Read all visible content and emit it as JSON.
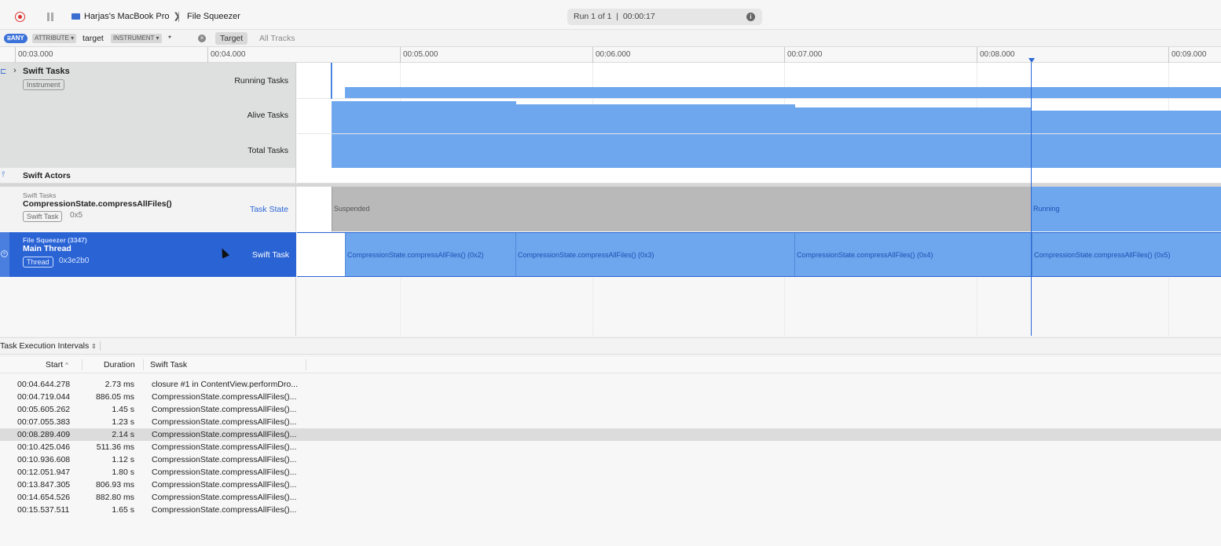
{
  "toolbar": {
    "device": "Harjas's MacBook Pro",
    "separator": "❯",
    "target": "File Squeezer",
    "run_info": "Run 1 of 1  |  00:00:17",
    "info_icon": "i"
  },
  "filter": {
    "any_label": "ANY",
    "attribute_label": "ATTRIBUTE",
    "attribute_value": "target",
    "instrument_label": "INSTRUMENT",
    "instrument_value": "*",
    "target_button": "Target",
    "all_tracks_button": "All Tracks"
  },
  "ruler": {
    "ticks": [
      "00:03.000",
      "00:04.000",
      "00:05.000",
      "00:06.000",
      "00:07.000",
      "00:08.000",
      "00:09.000"
    ]
  },
  "tracks": {
    "swift_tasks": {
      "title": "Swift Tasks",
      "badge": "Instrument",
      "rows": [
        "Running Tasks",
        "Alive Tasks",
        "Total Tasks"
      ]
    },
    "swift_actors": {
      "title": "Swift Actors"
    },
    "task_state": {
      "subtitle": "Swift Tasks",
      "title": "CompressionState.compressAllFiles()",
      "badge": "Swift Task",
      "id": "0x5",
      "lane_label": "Task State",
      "state_suspended": "Suspended",
      "state_running": "Running"
    },
    "main_thread": {
      "subtitle": "File Squeezer (3347)",
      "title": "Main Thread",
      "badge": "Thread",
      "id": "0x3e2b0",
      "lane_label": "Swift Task",
      "segments": [
        "CompressionState.compressAllFiles() (0x2)",
        "CompressionState.compressAllFiles() (0x3)",
        "CompressionState.compressAllFiles() (0x4)",
        "CompressionState.compressAllFiles() (0x5)"
      ]
    }
  },
  "detail": {
    "selector": "Task Execution Intervals",
    "columns": {
      "start": "Start",
      "duration": "Duration",
      "task": "Swift Task"
    },
    "rows": [
      {
        "start": "00:04.644.278",
        "duration": "2.73 ms",
        "task": "closure #1 in ContentView.performDro..."
      },
      {
        "start": "00:04.719.044",
        "duration": "886.05 ms",
        "task": "CompressionState.compressAllFiles()..."
      },
      {
        "start": "00:05.605.262",
        "duration": "1.45 s",
        "task": "CompressionState.compressAllFiles()..."
      },
      {
        "start": "00:07.055.383",
        "duration": "1.23 s",
        "task": "CompressionState.compressAllFiles()..."
      },
      {
        "start": "00:08.289.409",
        "duration": "2.14 s",
        "task": "CompressionState.compressAllFiles()..."
      },
      {
        "start": "00:10.425.046",
        "duration": "511.36 ms",
        "task": "CompressionState.compressAllFiles()..."
      },
      {
        "start": "00:10.936.608",
        "duration": "1.12 s",
        "task": "CompressionState.compressAllFiles()..."
      },
      {
        "start": "00:12.051.947",
        "duration": "1.80 s",
        "task": "CompressionState.compressAllFiles()..."
      },
      {
        "start": "00:13.847.305",
        "duration": "806.93 ms",
        "task": "CompressionState.compressAllFiles()..."
      },
      {
        "start": "00:14.654.526",
        "duration": "882.80 ms",
        "task": "CompressionState.compressAllFiles()..."
      },
      {
        "start": "00:15.537.511",
        "duration": "1.65 s",
        "task": "CompressionState.compressAllFiles()..."
      }
    ]
  }
}
